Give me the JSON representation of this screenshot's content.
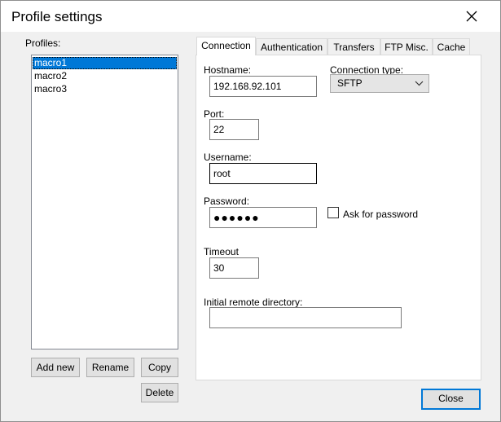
{
  "window": {
    "title": "Profile settings"
  },
  "profiles": {
    "label": "Profiles:",
    "items": [
      "macro1",
      "macro2",
      "macro3"
    ],
    "selected": "macro1"
  },
  "buttons": {
    "add_new": "Add new",
    "rename": "Rename",
    "copy": "Copy",
    "delete": "Delete",
    "close": "Close"
  },
  "tabs": [
    {
      "label": "Connection",
      "active": true
    },
    {
      "label": "Authentication",
      "active": false
    },
    {
      "label": "Transfers",
      "active": false
    },
    {
      "label": "FTP Misc.",
      "active": false
    },
    {
      "label": "Cache",
      "active": false
    }
  ],
  "connection": {
    "hostname_label": "Hostname:",
    "hostname": "192.168.92.101",
    "conn_type_label": "Connection type:",
    "conn_type": "SFTP",
    "port_label": "Port:",
    "port": "22",
    "username_label": "Username:",
    "username": "root",
    "password_label": "Password:",
    "password_masked": "●●●●●●",
    "ask_password_label": "Ask for password",
    "timeout_label": "Timeout",
    "timeout": "30",
    "remote_dir_label": "Initial remote directory:",
    "remote_dir": ""
  },
  "icons": {
    "close": "close-icon",
    "dropdown": "chevron-down-icon",
    "checkbox": "checkbox-icon"
  },
  "colors": {
    "selection": "#0078d7",
    "default_button_border": "#0078d7",
    "dialog_bg": "#f0f0f0"
  }
}
